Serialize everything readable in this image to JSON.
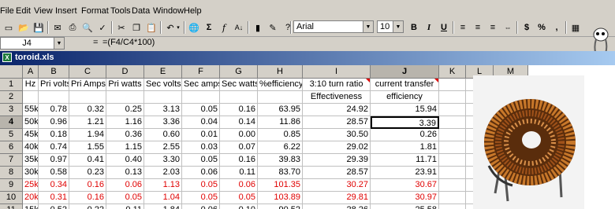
{
  "menu": [
    "File",
    "Edit",
    "View",
    "Insert",
    "Format",
    "Tools",
    "Data",
    "Window",
    "Help"
  ],
  "toolbar": {
    "font_name": "Arial",
    "font_size": "10",
    "bold_label": "B",
    "italic_label": "I",
    "underline_label": "U",
    "currency_label": "$",
    "percent_label": "%",
    "comma_label": ","
  },
  "formula_bar": {
    "cell_ref": "J4",
    "equals": "=",
    "formula": "=(F4/C4*100)"
  },
  "workbook": {
    "title": "toroid.xls"
  },
  "columns": [
    "A",
    "B",
    "C",
    "D",
    "E",
    "F",
    "G",
    "H",
    "I",
    "J",
    "K",
    "L",
    "M"
  ],
  "rows": [
    {
      "n": "1",
      "red": false,
      "cells": [
        "Hz",
        "Pri volts",
        "Pri Amps",
        "Pri watts",
        "Sec volts",
        "Sec amps",
        "Sec watts",
        "%efficiency",
        "3:10 turn ratio",
        "current transfer"
      ]
    },
    {
      "n": "2",
      "red": false,
      "cells": [
        "",
        "",
        "",
        "",
        "",
        "",
        "",
        "",
        "Effectiveness",
        "efficiency"
      ]
    },
    {
      "n": "3",
      "red": false,
      "cells": [
        "55k",
        "0.78",
        "0.32",
        "0.25",
        "3.13",
        "0.05",
        "0.16",
        "63.95",
        "24.92",
        "15.94"
      ]
    },
    {
      "n": "4",
      "red": false,
      "cells": [
        "50k",
        "0.96",
        "1.21",
        "1.16",
        "3.36",
        "0.04",
        "0.14",
        "11.86",
        "28.57",
        "3.39"
      ]
    },
    {
      "n": "5",
      "red": false,
      "cells": [
        "45k",
        "0.18",
        "1.94",
        "0.36",
        "0.60",
        "0.01",
        "0.00",
        "0.85",
        "30.50",
        "0.26"
      ]
    },
    {
      "n": "6",
      "red": false,
      "cells": [
        "40k",
        "0.74",
        "1.55",
        "1.15",
        "2.55",
        "0.03",
        "0.07",
        "6.22",
        "29.02",
        "1.81"
      ]
    },
    {
      "n": "7",
      "red": false,
      "cells": [
        "35k",
        "0.97",
        "0.41",
        "0.40",
        "3.30",
        "0.05",
        "0.16",
        "39.83",
        "29.39",
        "11.71"
      ]
    },
    {
      "n": "8",
      "red": false,
      "cells": [
        "30k",
        "0.58",
        "0.23",
        "0.13",
        "2.03",
        "0.06",
        "0.11",
        "83.70",
        "28.57",
        "23.91"
      ]
    },
    {
      "n": "9",
      "red": true,
      "cells": [
        "25k",
        "0.34",
        "0.16",
        "0.06",
        "1.13",
        "0.05",
        "0.06",
        "101.35",
        "30.27",
        "30.67"
      ]
    },
    {
      "n": "10",
      "red": true,
      "cells": [
        "20k",
        "0.31",
        "0.16",
        "0.05",
        "1.04",
        "0.05",
        "0.05",
        "103.89",
        "29.81",
        "30.97"
      ]
    },
    {
      "n": "11",
      "red": false,
      "cells": [
        "15k",
        "0.52",
        "0.22",
        "0.11",
        "1.84",
        "0.06",
        "0.10",
        "90.52",
        "28.26",
        "25.58"
      ]
    }
  ],
  "colors": {
    "title_bar_start": "#0a246a",
    "title_bar_end": "#a6caf0",
    "highlight_text": "#e00000",
    "copper": "#b5651d"
  }
}
